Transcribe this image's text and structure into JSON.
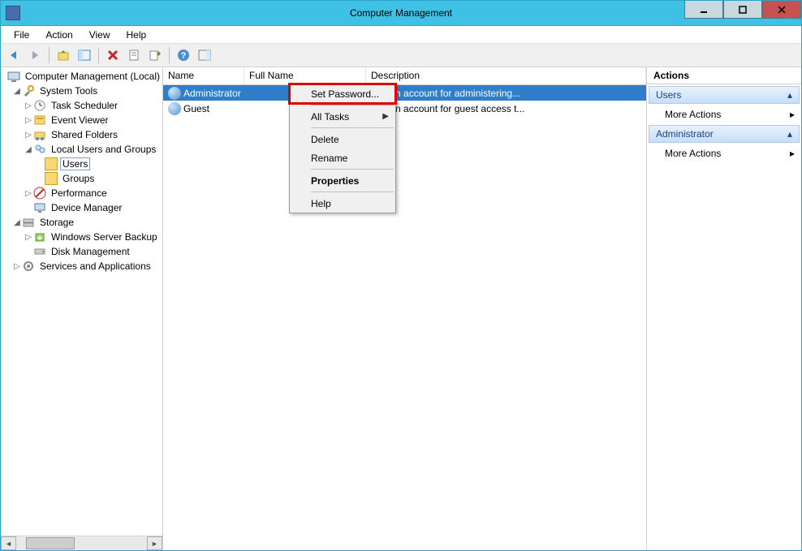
{
  "window": {
    "title": "Computer Management"
  },
  "menu": {
    "file": "File",
    "action": "Action",
    "view": "View",
    "help": "Help"
  },
  "tree": {
    "root": "Computer Management (Local)",
    "system_tools": "System Tools",
    "task_scheduler": "Task Scheduler",
    "event_viewer": "Event Viewer",
    "shared_folders": "Shared Folders",
    "local_users": "Local Users and Groups",
    "users": "Users",
    "groups": "Groups",
    "performance": "Performance",
    "device_manager": "Device Manager",
    "storage": "Storage",
    "wsb": "Windows Server Backup",
    "disk_mgmt": "Disk Management",
    "services_apps": "Services and Applications"
  },
  "columns": {
    "name": "Name",
    "full": "Full Name",
    "desc": "Description"
  },
  "users": [
    {
      "name": "Administrator",
      "full": "",
      "desc": "Built-in account for administering...",
      "selected": true
    },
    {
      "name": "Guest",
      "full": "",
      "desc": "Built-in account for guest access t...",
      "selected": false
    }
  ],
  "context_menu": {
    "set_password": "Set Password...",
    "all_tasks": "All Tasks",
    "delete": "Delete",
    "rename": "Rename",
    "properties": "Properties",
    "help": "Help"
  },
  "actions": {
    "header": "Actions",
    "sections": [
      {
        "title": "Users",
        "items": [
          "More Actions"
        ]
      },
      {
        "title": "Administrator",
        "items": [
          "More Actions"
        ]
      }
    ]
  }
}
